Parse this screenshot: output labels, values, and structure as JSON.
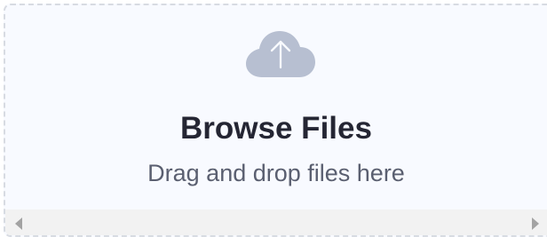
{
  "upload": {
    "title": "Browse Files",
    "subtitle": "Drag and drop files here",
    "icon": "cloud-upload-icon"
  },
  "colors": {
    "background": "#f8faff",
    "border": "#d7dbe2",
    "title": "#252633",
    "subtitle": "#5a5f70",
    "icon": "#b7bfd1",
    "scrollbar": "#f2f2f2",
    "scroll_arrow": "#a3a3a3"
  },
  "scrollbar": {
    "left_icon": "scroll-left-icon",
    "right_icon": "scroll-right-icon"
  }
}
